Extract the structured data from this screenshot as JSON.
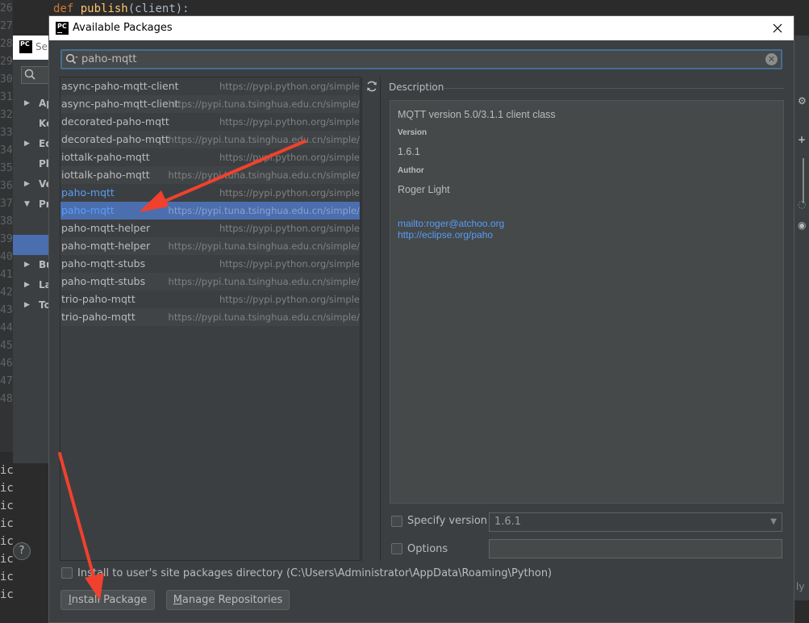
{
  "background": {
    "line_numbers": [
      "26",
      "27",
      "28",
      "29",
      "30",
      "31",
      "32",
      "33",
      "34",
      "35",
      "36",
      "37",
      "38",
      "39",
      "40",
      "41",
      "42",
      "43",
      "44",
      "45",
      "46",
      "47",
      "48"
    ],
    "code_keyword": "def",
    "code_function": "publish",
    "code_rest": "(client):",
    "settings_title_fragment": "Se",
    "tree_items": [
      {
        "arrow": "▶",
        "label": "Ap"
      },
      {
        "arrow": "",
        "label": "Ke"
      },
      {
        "arrow": "▶",
        "label": "Ed"
      },
      {
        "arrow": "",
        "label": "Pl"
      },
      {
        "arrow": "▶",
        "label": "Ve"
      },
      {
        "arrow": "▼",
        "label": "Pr"
      },
      {
        "arrow": "",
        "label": ""
      },
      {
        "arrow": "",
        "label": ""
      },
      {
        "arrow": "▶",
        "label": "Bu"
      },
      {
        "arrow": "▶",
        "label": "La"
      },
      {
        "arrow": "▶",
        "label": "To"
      }
    ],
    "console_lines": [
      "ic",
      "ic",
      "ic",
      "ic",
      "ic",
      "ic",
      "ic",
      "ic"
    ],
    "help_label": "?",
    "apply_fragment": "ly"
  },
  "dialog": {
    "title": "Available Packages",
    "logo_text": "PC",
    "search": {
      "value": "paho-mqtt",
      "placeholder": ""
    },
    "packages": [
      {
        "name": "async-paho-mqtt-client",
        "repo": "https://pypi.python.org/simple",
        "installed": false,
        "selected": false
      },
      {
        "name": "async-paho-mqtt-client",
        "repo": "https://pypi.tuna.tsinghua.edu.cn/simple/",
        "installed": false,
        "selected": false
      },
      {
        "name": "decorated-paho-mqtt",
        "repo": "https://pypi.python.org/simple",
        "installed": false,
        "selected": false
      },
      {
        "name": "decorated-paho-mqtt",
        "repo": "https://pypi.tuna.tsinghua.edu.cn/simple/",
        "installed": false,
        "selected": false
      },
      {
        "name": "iottalk-paho-mqtt",
        "repo": "https://pypi.python.org/simple",
        "installed": false,
        "selected": false
      },
      {
        "name": "iottalk-paho-mqtt",
        "repo": "https://pypi.tuna.tsinghua.edu.cn/simple/",
        "installed": false,
        "selected": false
      },
      {
        "name": "paho-mqtt",
        "repo": "https://pypi.python.org/simple",
        "installed": true,
        "selected": false
      },
      {
        "name": "paho-mqtt",
        "repo": "https://pypi.tuna.tsinghua.edu.cn/simple/",
        "installed": true,
        "selected": true
      },
      {
        "name": "paho-mqtt-helper",
        "repo": "https://pypi.python.org/simple",
        "installed": false,
        "selected": false
      },
      {
        "name": "paho-mqtt-helper",
        "repo": "https://pypi.tuna.tsinghua.edu.cn/simple/",
        "installed": false,
        "selected": false
      },
      {
        "name": "paho-mqtt-stubs",
        "repo": "https://pypi.python.org/simple",
        "installed": false,
        "selected": false
      },
      {
        "name": "paho-mqtt-stubs",
        "repo": "https://pypi.tuna.tsinghua.edu.cn/simple/",
        "installed": false,
        "selected": false
      },
      {
        "name": "trio-paho-mqtt",
        "repo": "https://pypi.python.org/simple",
        "installed": false,
        "selected": false
      },
      {
        "name": "trio-paho-mqtt",
        "repo": "https://pypi.tuna.tsinghua.edu.cn/simple/",
        "installed": false,
        "selected": false
      }
    ],
    "description": {
      "label": "Description",
      "summary": "MQTT version 5.0/3.1.1 client class",
      "version_heading": "Version",
      "version_value": "1.6.1",
      "author_heading": "Author",
      "author_value": "Roger Light",
      "email_link": "mailto:roger@atchoo.org",
      "home_link": "http://eclipse.org/paho"
    },
    "specify_version_label": "Specify version",
    "specify_version_checked": false,
    "version_selected": "1.6.1",
    "options_label": "Options",
    "options_value": "",
    "install_to_user_label": "Install to user's site packages directory (C:\\Users\\Administrator\\AppData\\Roaming\\Python)",
    "install_to_user_checked": false,
    "install_button": "Install Package",
    "manage_button": "Manage Repositories"
  },
  "colors": {
    "accent_selection": "#4b6eaf",
    "installed_text": "#589df6",
    "annotation_arrow": "#f0412e"
  }
}
